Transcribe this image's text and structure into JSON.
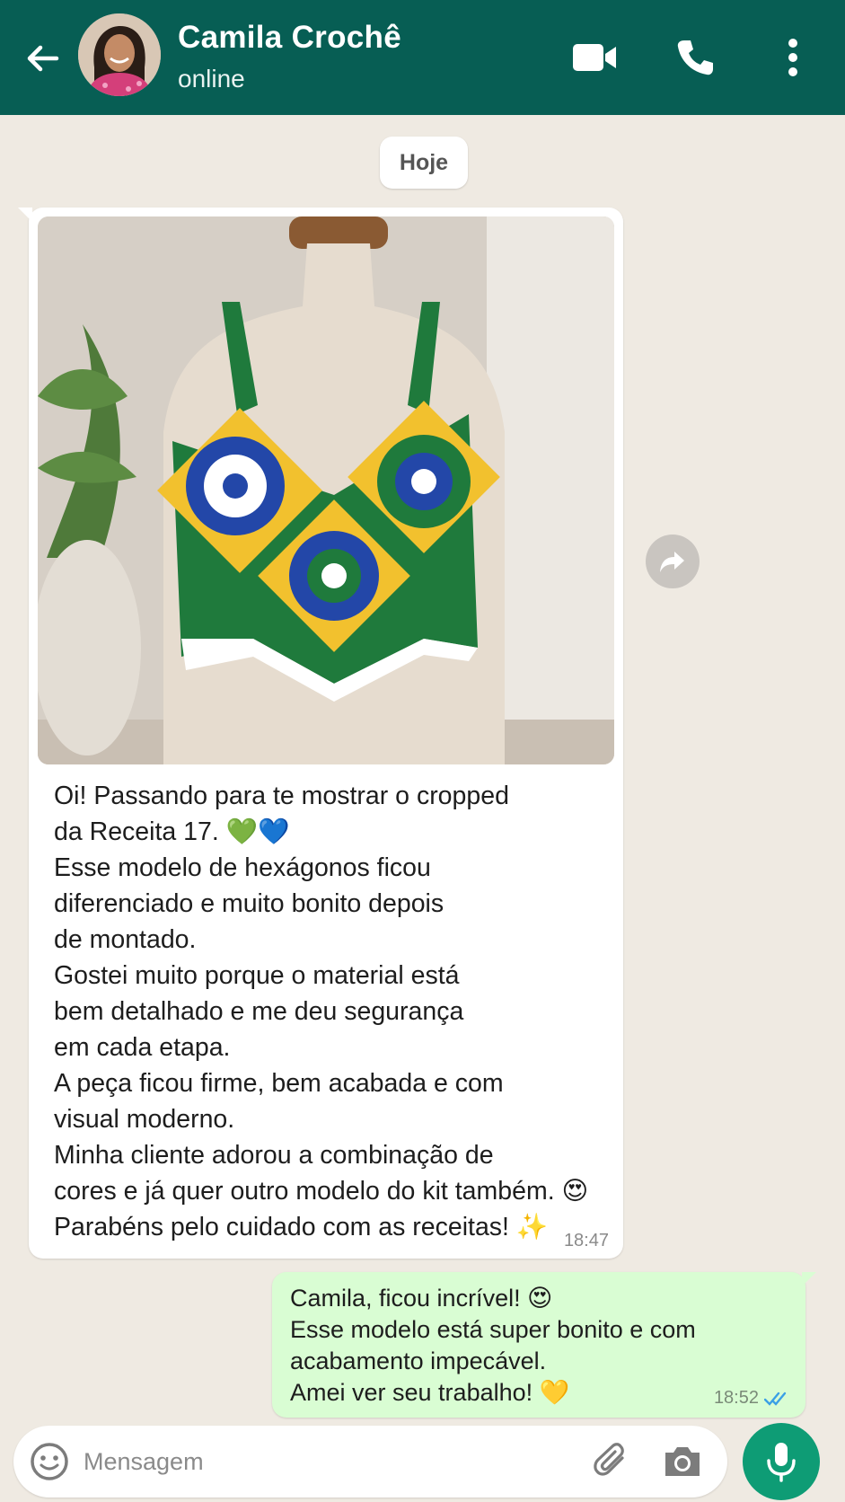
{
  "header": {
    "contact_name": "Camila Crochê",
    "status": "online",
    "icons": [
      "back-arrow-icon",
      "video-camera-icon",
      "phone-icon",
      "more-vertical-icon"
    ],
    "color": "#075e54"
  },
  "chat": {
    "date_label": "Hoje",
    "incoming": {
      "text": "Oi! Passando para te mostrar o cropped\nda Receita 17. 💚💙\nEsse modelo de hexágonos ficou\ndiferenciado e muito bonito depois\nde montado.\nGostei muito porque o material está\nbem detalhado e me deu segurança\nem cada etapa.\nA peça ficou firme, bem acabada e com\nvisual moderno.\nMinha cliente adorou a combinação de\ncores e já quer outro modelo do kit também. 😍\nParabéns pelo cuidado com as receitas! ✨",
      "time": "18:47"
    },
    "outgoing": {
      "text": "Camila, ficou incrível! 😍\nEsse modelo está super bonito e com\nacabamento impecável.\nAmei ver seu trabalho! 💛",
      "time": "18:52",
      "status_icon": "double-check-icon"
    }
  },
  "input": {
    "placeholder": "Mensagem",
    "icons": [
      "emoji-icon",
      "paperclip-icon",
      "camera-icon",
      "microphone-icon"
    ],
    "accent": "#0e9c75"
  }
}
